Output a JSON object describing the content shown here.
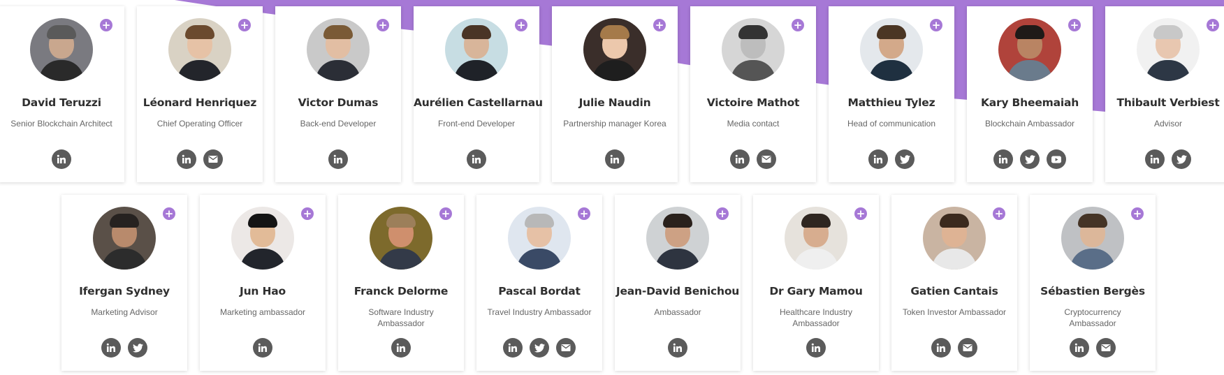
{
  "theme": {
    "accent": "#a678d6",
    "icon_bg": "#5b5b5b"
  },
  "members_row1": [
    {
      "name": "David Teruzzi",
      "role": "Senior Blockchain Architect",
      "socials": [
        "linkedin-icon"
      ],
      "bg": "#7a7a80",
      "skin": "#c9a78e",
      "hair": "#5a5a5a",
      "shirt": "#2a2a2a"
    },
    {
      "name": "Léonard Henriquez",
      "role": "Chief Operating Officer",
      "socials": [
        "linkedin-icon",
        "mail-icon"
      ],
      "bg": "#d9d2c4",
      "skin": "#e6c2a6",
      "hair": "#6b4a2e",
      "shirt": "#23252b"
    },
    {
      "name": "Victor Dumas",
      "role": "Back-end Developer",
      "socials": [
        "linkedin-icon"
      ],
      "bg": "#c9c9c9",
      "skin": "#e2bea3",
      "hair": "#7a5a36",
      "shirt": "#2b2e36"
    },
    {
      "name": "Aurélien Castellarnau",
      "role": "Front-end Developer",
      "socials": [
        "linkedin-icon"
      ],
      "bg": "#c7dde3",
      "skin": "#d8b59a",
      "hair": "#4a3526",
      "shirt": "#1f2228"
    },
    {
      "name": "Julie Naudin",
      "role": "Partnership manager Korea",
      "socials": [
        "linkedin-icon"
      ],
      "bg": "#3a2e2a",
      "skin": "#ecc8ac",
      "hair": "#a57a4a",
      "shirt": "#1e1e1e"
    },
    {
      "name": "Victoire Mathot",
      "role": "Media contact",
      "socials": [
        "linkedin-icon",
        "mail-icon"
      ],
      "bg": "#d6d6d6",
      "skin": "#bdbdbd",
      "hair": "#333333",
      "shirt": "#555555"
    },
    {
      "name": "Matthieu Tylez",
      "role": "Head of communication",
      "socials": [
        "linkedin-icon",
        "twitter-icon"
      ],
      "bg": "#e4e8ec",
      "skin": "#d3a98a",
      "hair": "#4b3624",
      "shirt": "#1f3040"
    },
    {
      "name": "Kary Bheemaiah",
      "role": "Blockchain Ambassador",
      "socials": [
        "linkedin-icon",
        "twitter-icon",
        "youtube-icon"
      ],
      "bg": "#b0433b",
      "skin": "#b98463",
      "hair": "#1e1a18",
      "shirt": "#6a7b8c"
    },
    {
      "name": "Thibault Verbiest",
      "role": "Advisor",
      "socials": [
        "linkedin-icon",
        "twitter-icon"
      ],
      "bg": "#f1f1f1",
      "skin": "#e8c7b0",
      "hair": "#c8c8c8",
      "shirt": "#2d3745"
    }
  ],
  "members_row2": [
    {
      "name": "Ifergan Sydney",
      "role": "Marketing Advisor",
      "socials": [
        "linkedin-icon",
        "twitter-icon"
      ],
      "bg": "#5a5048",
      "skin": "#b88a6c",
      "hair": "#262220",
      "shirt": "#2c2c2c"
    },
    {
      "name": "Jun Hao",
      "role": "Marketing ambassador",
      "socials": [
        "linkedin-icon"
      ],
      "bg": "#ece8e6",
      "skin": "#e2bb98",
      "hair": "#141414",
      "shirt": "#22252c"
    },
    {
      "name": "Franck Delorme",
      "role": "Software Industry Ambassador",
      "socials": [
        "linkedin-icon"
      ],
      "bg": "#7d6a2c",
      "skin": "#cf8f6d",
      "hair": "#9c7f5a",
      "shirt": "#333a48"
    },
    {
      "name": "Pascal Bordat",
      "role": "Travel Industry Ambassador",
      "socials": [
        "linkedin-icon",
        "twitter-icon",
        "mail-icon"
      ],
      "bg": "#dfe6ef",
      "skin": "#e6c1a6",
      "hair": "#b8b8b8",
      "shirt": "#3a4a66"
    },
    {
      "name": "Jean-David Benichou",
      "role": "Ambassador",
      "socials": [
        "linkedin-icon"
      ],
      "bg": "#cfd2d4",
      "skin": "#cda184",
      "hair": "#2a211c",
      "shirt": "#2e3440"
    },
    {
      "name": "Dr Gary Mamou",
      "role": "Healthcare Industry Ambassador",
      "socials": [
        "linkedin-icon"
      ],
      "bg": "#e6e2dc",
      "skin": "#d7ad8f",
      "hair": "#2f2620",
      "shirt": "#efefef"
    },
    {
      "name": "Gatien Cantais",
      "role": "Token Investor Ambassador",
      "socials": [
        "linkedin-icon",
        "mail-icon"
      ],
      "bg": "#c9b4a2",
      "skin": "#deb394",
      "hair": "#3b2a1e",
      "shirt": "#e8e8e8"
    },
    {
      "name": "Sébastien Bergès",
      "role": "Cryptocurrency Ambassador",
      "socials": [
        "linkedin-icon",
        "mail-icon"
      ],
      "bg": "#bfc1c4",
      "skin": "#dcb79a",
      "hair": "#453426",
      "shirt": "#5a6e88"
    }
  ]
}
